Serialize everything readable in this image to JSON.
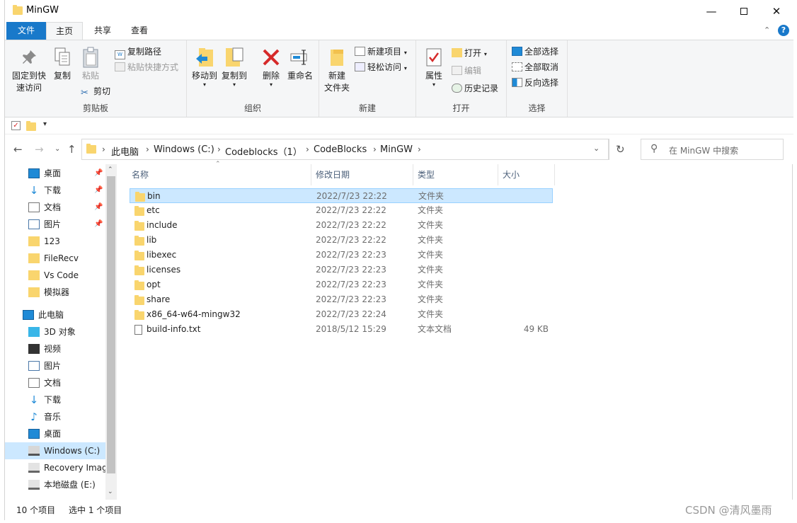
{
  "window": {
    "title": "MinGW",
    "minimize_icon": "minimize-icon",
    "maximize_icon": "maximize-icon",
    "close_icon": "close-icon"
  },
  "ribbon_tabs": {
    "file": "文件",
    "home": "主页",
    "share": "共享",
    "view": "查看"
  },
  "clipboard": {
    "pin": "固定到快\n速访问",
    "pin_line1": "固定到快",
    "pin_line2": "速访问",
    "copy": "复制",
    "paste": "粘贴",
    "copy_path": "复制路径",
    "paste_shortcut": "粘贴快捷方式",
    "cut": "剪切",
    "label": "剪贴板"
  },
  "organize": {
    "move_to": "移动到",
    "copy_to": "复制到",
    "delete": "删除",
    "rename": "重命名",
    "label": "组织"
  },
  "new_group": {
    "new_folder_line1": "新建",
    "new_folder_line2": "文件夹",
    "new_item": "新建项目",
    "easy_access": "轻松访问",
    "label": "新建"
  },
  "open_group": {
    "properties": "属性",
    "open": "打开",
    "edit": "编辑",
    "history": "历史记录",
    "label": "打开"
  },
  "select_group": {
    "select_all": "全部选择",
    "select_none": "全部取消",
    "invert": "反向选择",
    "label": "选择"
  },
  "address": {
    "crumbs": [
      "此电脑",
      "Windows (C:)",
      "Codeblocks（1）",
      "CodeBlocks",
      "MinGW"
    ],
    "search_placeholder": "在 MinGW 中搜索"
  },
  "sidebar": {
    "quick_access": [
      {
        "label": "桌面",
        "icon": "desktop-icon",
        "pinned": true
      },
      {
        "label": "下载",
        "icon": "download-icon",
        "pinned": true
      },
      {
        "label": "文档",
        "icon": "document-icon",
        "pinned": true
      },
      {
        "label": "图片",
        "icon": "picture-icon",
        "pinned": true
      },
      {
        "label": "123",
        "icon": "folder-icon",
        "pinned": false
      },
      {
        "label": "FileRecv",
        "icon": "folder-icon",
        "pinned": false
      },
      {
        "label": "Vs Code",
        "icon": "folder-icon",
        "pinned": false
      },
      {
        "label": "模拟器",
        "icon": "folder-icon",
        "pinned": false
      }
    ],
    "this_pc": "此电脑",
    "pc_items": [
      {
        "label": "3D 对象",
        "icon": "cube-icon"
      },
      {
        "label": "视频",
        "icon": "video-icon"
      },
      {
        "label": "图片",
        "icon": "picture-icon"
      },
      {
        "label": "文档",
        "icon": "document-icon"
      },
      {
        "label": "下载",
        "icon": "download-icon"
      },
      {
        "label": "音乐",
        "icon": "music-icon"
      },
      {
        "label": "桌面",
        "icon": "desktop-icon"
      },
      {
        "label": "Windows (C:)",
        "icon": "windows-drive-icon"
      },
      {
        "label": "Recovery Imag",
        "icon": "drive-icon"
      },
      {
        "label": "本地磁盘 (E:)",
        "icon": "drive-icon"
      }
    ]
  },
  "columns": {
    "name": "名称",
    "date": "修改日期",
    "type": "类型",
    "size": "大小"
  },
  "files": [
    {
      "name": "bin",
      "date": "2022/7/23 22:22",
      "type": "文件夹",
      "size": "",
      "icon": "folder-icon"
    },
    {
      "name": "etc",
      "date": "2022/7/23 22:22",
      "type": "文件夹",
      "size": "",
      "icon": "folder-icon"
    },
    {
      "name": "include",
      "date": "2022/7/23 22:22",
      "type": "文件夹",
      "size": "",
      "icon": "folder-icon"
    },
    {
      "name": "lib",
      "date": "2022/7/23 22:22",
      "type": "文件夹",
      "size": "",
      "icon": "folder-icon"
    },
    {
      "name": "libexec",
      "date": "2022/7/23 22:23",
      "type": "文件夹",
      "size": "",
      "icon": "folder-icon"
    },
    {
      "name": "licenses",
      "date": "2022/7/23 22:23",
      "type": "文件夹",
      "size": "",
      "icon": "folder-icon"
    },
    {
      "name": "opt",
      "date": "2022/7/23 22:23",
      "type": "文件夹",
      "size": "",
      "icon": "folder-icon"
    },
    {
      "name": "share",
      "date": "2022/7/23 22:23",
      "type": "文件夹",
      "size": "",
      "icon": "folder-icon"
    },
    {
      "name": "x86_64-w64-mingw32",
      "date": "2022/7/23 22:24",
      "type": "文件夹",
      "size": "",
      "icon": "folder-icon"
    },
    {
      "name": "build-info.txt",
      "date": "2018/5/12 15:29",
      "type": "文本文档",
      "size": "49 KB",
      "icon": "text-file-icon"
    }
  ],
  "selected_index": 0,
  "status": {
    "count": "10 个项目",
    "selected": "选中 1 个项目"
  },
  "watermark": "CSDN @清风墨雨",
  "colors": {
    "file_tab": "#1979ca",
    "selection": "#cce8ff",
    "folder": "#f9d56e",
    "delete_red": "#d62a2a"
  }
}
